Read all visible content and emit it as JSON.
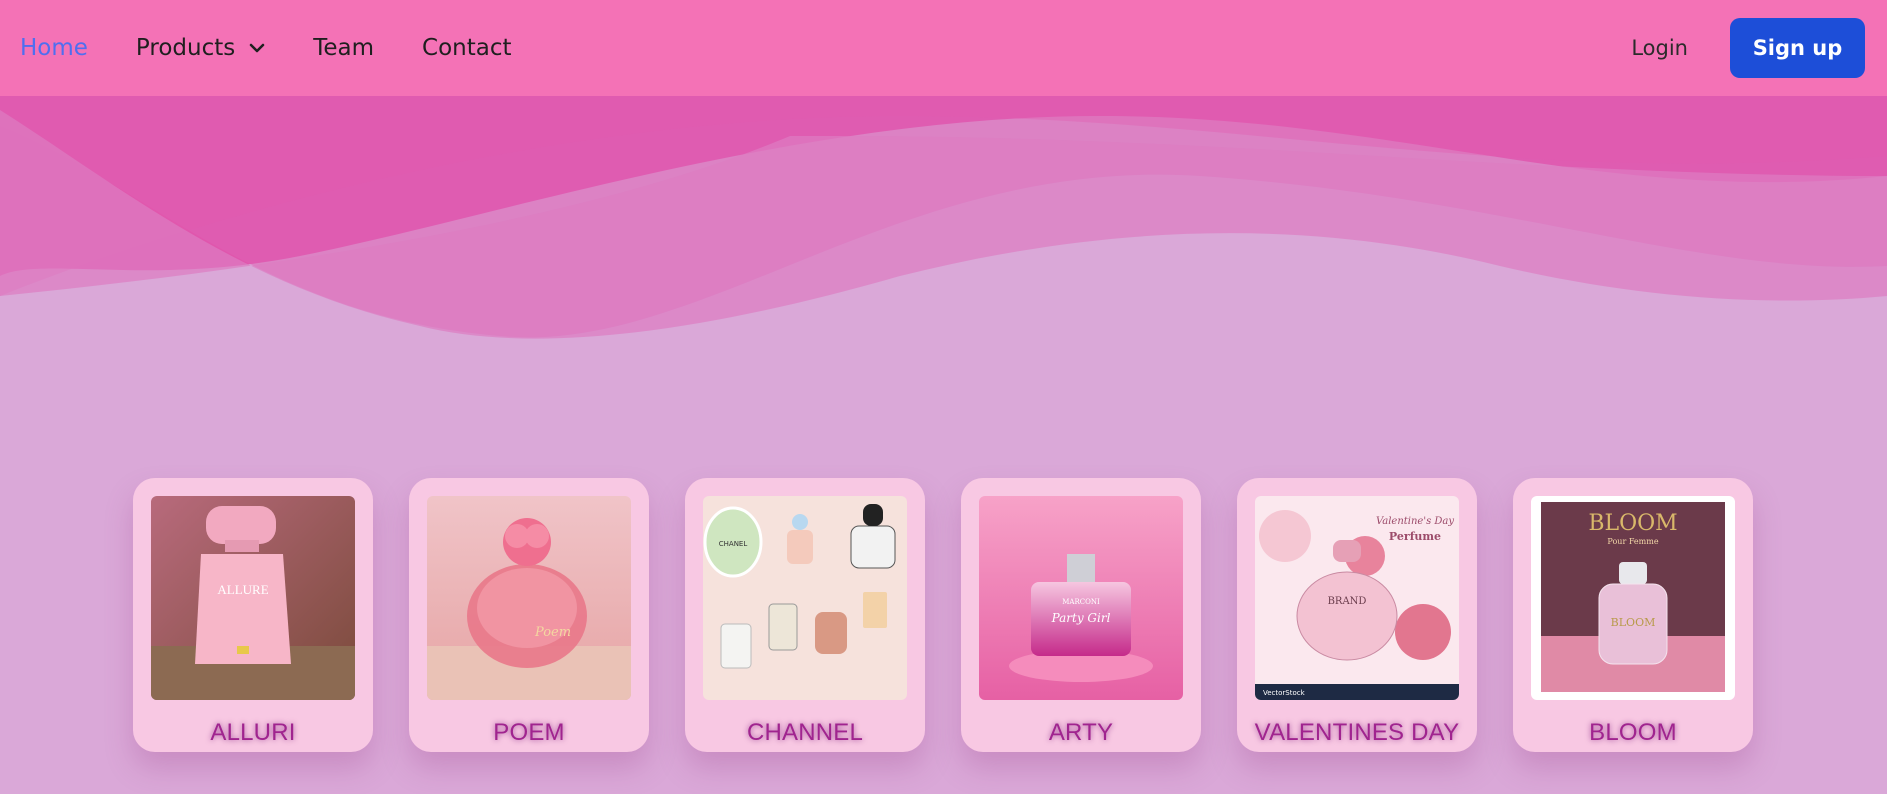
{
  "nav": {
    "home": "Home",
    "products": "Products",
    "team": "Team",
    "contact": "Contact",
    "login": "Login",
    "signup": "Sign up"
  },
  "products": [
    {
      "name": "ALLURI",
      "image_text": "ALLURE"
    },
    {
      "name": "POEM",
      "image_text": "Poem"
    },
    {
      "name": "CHANNEL",
      "image_text": "CHANEL"
    },
    {
      "name": "ARTY",
      "image_text": "Party Girl",
      "image_brand": "MARCONI"
    },
    {
      "name": "VALENTINES DAY",
      "image_title": "Valentine's Day",
      "image_subtitle": "Perfume",
      "image_brand": "BRAND",
      "image_footer": "VectorStock"
    },
    {
      "name": "BLOOM",
      "image_title": "BLOOM",
      "image_subtitle": "Pour Femme"
    }
  ],
  "colors": {
    "navbar": "#f472b6",
    "page_bg": "#daa8d8",
    "signup_bg": "#1d4ed8",
    "active_link": "#4f6ef0",
    "card_bg": "#f8c8e3",
    "label": "#a0248f"
  },
  "icons": {
    "products_dropdown": "chevron-down-icon"
  }
}
